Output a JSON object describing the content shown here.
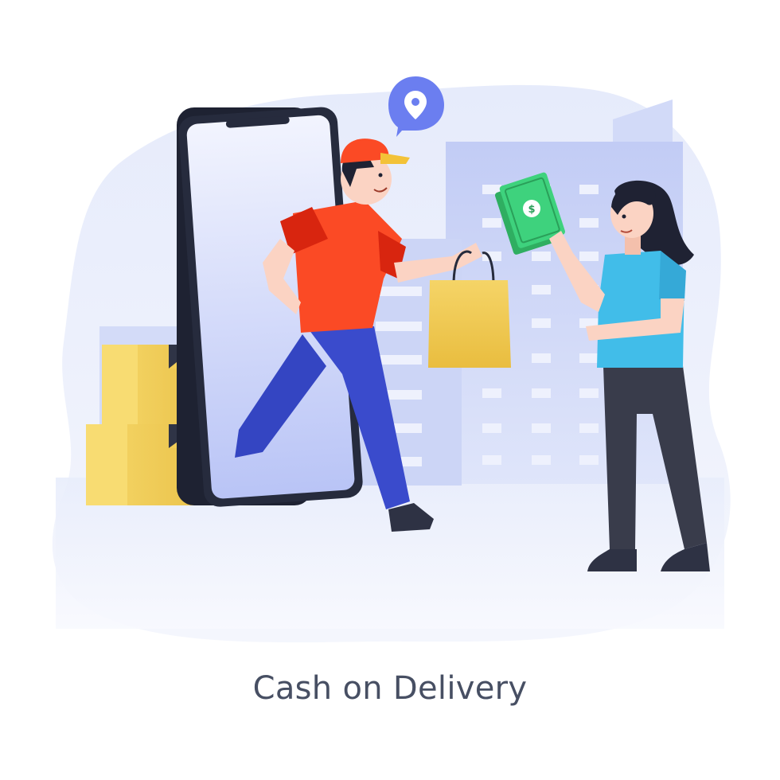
{
  "caption": "Cash on Delivery",
  "colors": {
    "blob": "#e3e9f9",
    "building": "#c7d2f7",
    "phone_frame": "#232738",
    "phone_screen": "#c6d0f8",
    "box": "#f1cd56",
    "shirt_red": "#fb4a25",
    "pants_blue": "#3543c3",
    "woman_top": "#41bde9",
    "woman_pants": "#3a3d4c",
    "bag": "#f2c94c",
    "cash": "#3ed27d",
    "pin": "#6c7ff1",
    "text": "#474f63"
  },
  "icons": [
    "location-pin-icon",
    "dollar-icon"
  ]
}
